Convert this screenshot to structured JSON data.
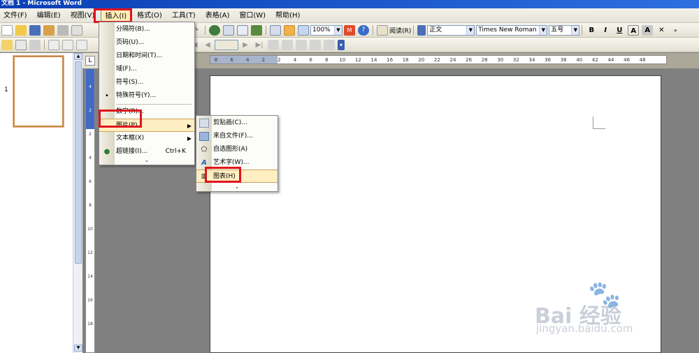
{
  "title_bar": {
    "text": "文档 1 - Microsoft Word"
  },
  "menubar": {
    "items": [
      "文件(F)",
      "编辑(E)",
      "视图(V)",
      "插入(I)",
      "格式(O)",
      "工具(T)",
      "表格(A)",
      "窗口(W)",
      "帮助(H)"
    ]
  },
  "toolbar": {
    "zoom": "100%",
    "read_label": "阅读(R)",
    "style": "正文",
    "font": "Times New Roman",
    "size": "五号",
    "bold": "B",
    "italic": "I",
    "underline": "U",
    "font_color": "A",
    "char_shading": "A"
  },
  "insert_menu": {
    "items": [
      {
        "label": "分隔符(B)..."
      },
      {
        "label": "页码(U)..."
      },
      {
        "label": "日期和时间(T)..."
      },
      {
        "label": "域(F)..."
      },
      {
        "label": "符号(S)..."
      },
      {
        "label": "特殊符号(Y)..."
      },
      {
        "label": "数字(R)..."
      },
      {
        "label": "图片(P)",
        "highlighted": true
      },
      {
        "label": "文本框(X)"
      },
      {
        "label": "超链接(I)...",
        "shortcut": "Ctrl+K"
      }
    ]
  },
  "picture_menu": {
    "items": [
      {
        "label": "剪贴画(C)..."
      },
      {
        "label": "来自文件(F)..."
      },
      {
        "label": "自选图形(A)"
      },
      {
        "label": "艺术字(W)..."
      },
      {
        "label": "图表(H)",
        "highlighted": true
      }
    ]
  },
  "ruler": {
    "h_labels": [
      "8",
      "6",
      "4",
      "2",
      "2",
      "4",
      "6",
      "8",
      "10",
      "12",
      "14",
      "16",
      "18",
      "20",
      "22",
      "24",
      "26",
      "28",
      "30",
      "32",
      "34",
      "36",
      "38",
      "40",
      "42",
      "44",
      "46",
      "48"
    ],
    "v_labels": [
      "4",
      "2",
      "2",
      "4",
      "6",
      "8",
      "10",
      "12",
      "14",
      "16",
      "18"
    ]
  },
  "thumbnail": {
    "page_number": "1"
  },
  "watermark": {
    "main": "Bai 经验",
    "sub": "jingyan.baidu.com"
  },
  "colors": {
    "highlight_box": "#e0141c",
    "menu_highlight": "#ffeec2",
    "title_bar": "#0a3fb5"
  }
}
